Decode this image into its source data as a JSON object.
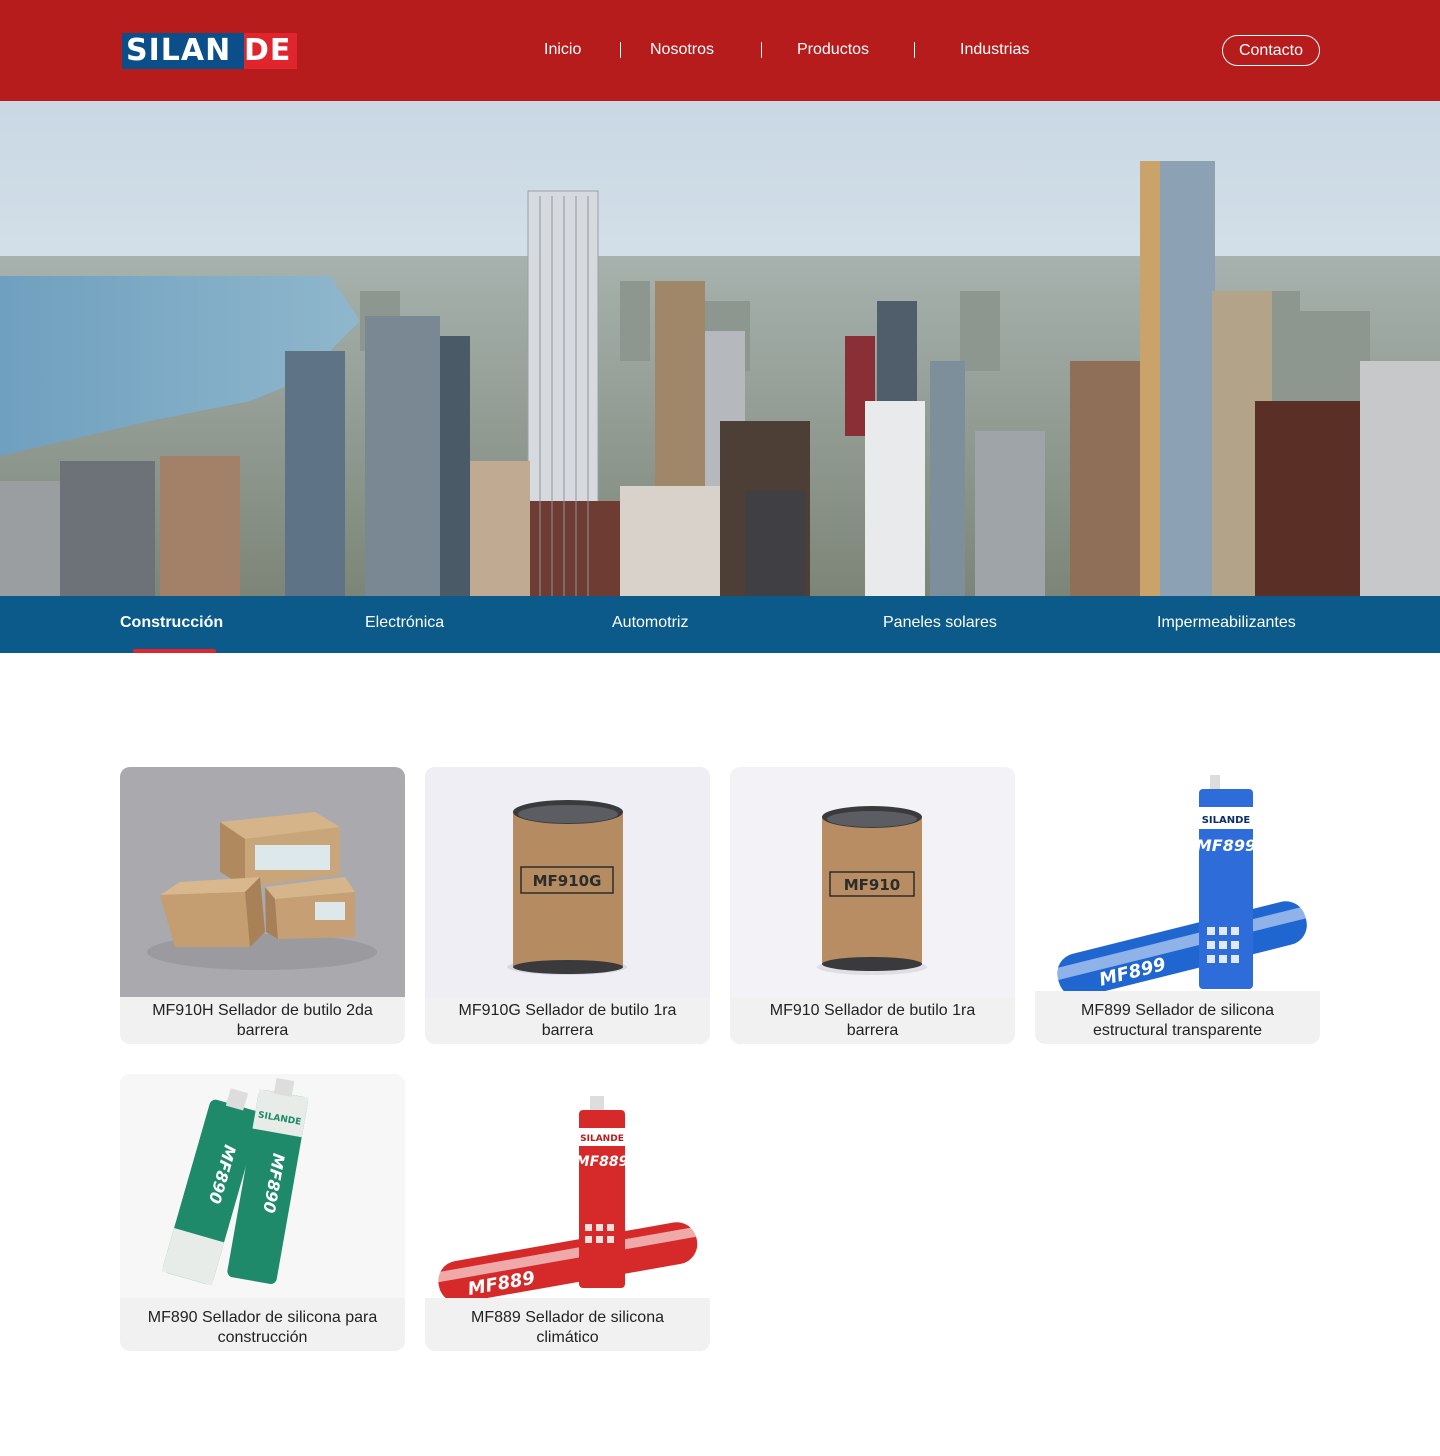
{
  "header": {
    "logo": {
      "part1": "SILAN",
      "part2": "DE"
    },
    "nav": [
      "Inicio",
      "Nosotros",
      "Productos",
      "Industrias"
    ],
    "contact_label": "Contacto"
  },
  "industry_tabs": {
    "items": [
      "Construcción",
      "Electrónica",
      "Automotriz",
      "Paneles solares",
      "Impermeabilizantes"
    ],
    "active": "Construcción"
  },
  "products": [
    {
      "caption": "MF910H Sellador de butilo 2da barrera"
    },
    {
      "caption": "MF910G Sellador de butilo 1ra barrera",
      "label": "MF910G"
    },
    {
      "caption": "MF910 Sellador de butilo 1ra barrera",
      "label": "MF910"
    },
    {
      "caption": "MF899 Sellador de silicona estructural transparente",
      "label": "MF899",
      "brand": "SILANDE"
    },
    {
      "caption": "MF890 Sellador de silicona para construcción",
      "label": "MF890",
      "brand": "SILANDE"
    },
    {
      "caption": "MF889 Sellador de silicona climático",
      "label": "MF889",
      "brand": "SILANDE"
    }
  ],
  "colors": {
    "header_red": "#b71c1c",
    "tab_blue": "#0b5a8a",
    "accent_red": "#e0262c",
    "logo_blue": "#0b4f8a"
  }
}
